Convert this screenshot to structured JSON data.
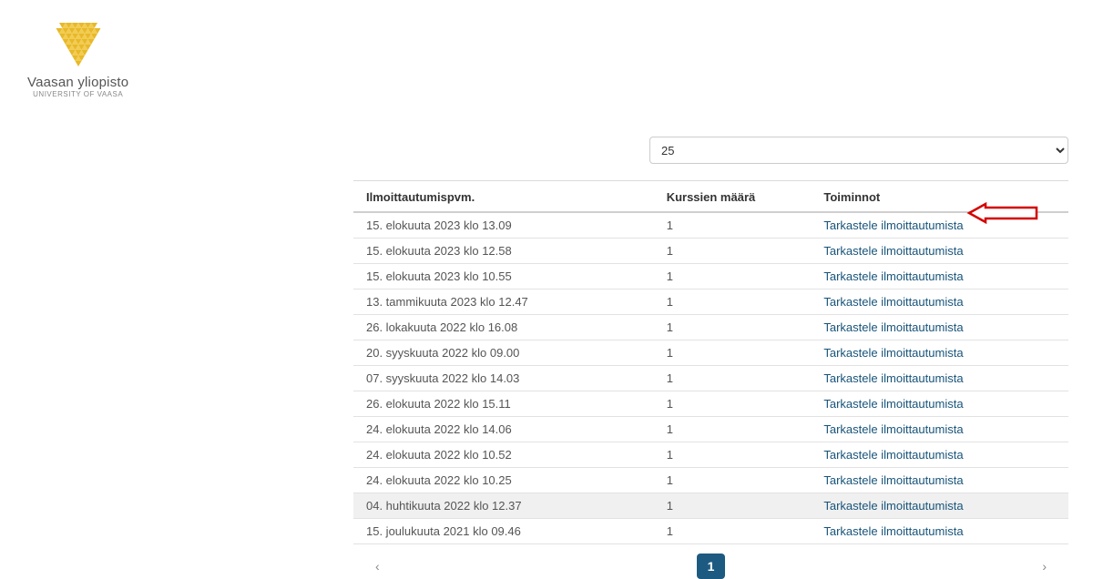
{
  "logo": {
    "title": "Vaasan yliopisto",
    "subtitle": "UNIVERSITY OF VAASA"
  },
  "pageSize": "25",
  "columns": {
    "date": "Ilmoittautumispvm.",
    "count": "Kurssien määrä",
    "actions": "Toiminnot"
  },
  "actionLabel": "Tarkastele ilmoittautumista",
  "rows": [
    {
      "date": "15. elokuuta 2023 klo 13.09",
      "count": "1",
      "highlight": false
    },
    {
      "date": "15. elokuuta 2023 klo 12.58",
      "count": "1",
      "highlight": false
    },
    {
      "date": "15. elokuuta 2023 klo 10.55",
      "count": "1",
      "highlight": false
    },
    {
      "date": "13. tammikuuta 2023 klo 12.47",
      "count": "1",
      "highlight": false
    },
    {
      "date": "26. lokakuuta 2022 klo 16.08",
      "count": "1",
      "highlight": false
    },
    {
      "date": "20. syyskuuta 2022 klo 09.00",
      "count": "1",
      "highlight": false
    },
    {
      "date": "07. syyskuuta 2022 klo 14.03",
      "count": "1",
      "highlight": false
    },
    {
      "date": "26. elokuuta 2022 klo 15.11",
      "count": "1",
      "highlight": false
    },
    {
      "date": "24. elokuuta 2022 klo 14.06",
      "count": "1",
      "highlight": false
    },
    {
      "date": "24. elokuuta 2022 klo 10.52",
      "count": "1",
      "highlight": false
    },
    {
      "date": "24. elokuuta 2022 klo 10.25",
      "count": "1",
      "highlight": false
    },
    {
      "date": "04. huhtikuuta 2022 klo 12.37",
      "count": "1",
      "highlight": true
    },
    {
      "date": "15. joulukuuta 2021 klo 09.46",
      "count": "1",
      "highlight": false
    }
  ],
  "pagination": {
    "prev": "‹",
    "current": "1",
    "next": "›"
  }
}
